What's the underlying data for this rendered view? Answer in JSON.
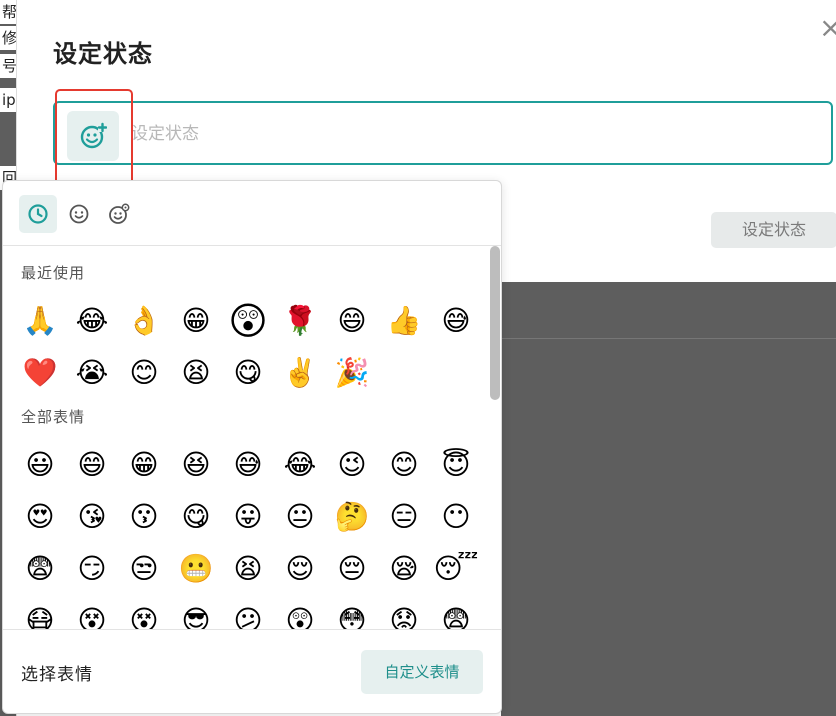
{
  "background": {
    "fragments": [
      "帮",
      "修",
      "号",
      "ip",
      "回"
    ]
  },
  "dialog": {
    "title": "设定状态",
    "close_glyph": "×",
    "input_placeholder": "设定状态",
    "confirm_label": "设定状态"
  },
  "picker": {
    "tabs": [
      {
        "icon": "clock-icon",
        "active": true
      },
      {
        "icon": "smiley-icon",
        "active": false
      },
      {
        "icon": "custom-emoji-icon",
        "active": false
      }
    ],
    "recent_title": "最近使用",
    "recent": [
      "🙏",
      "😂",
      "👌",
      "😁",
      "😲",
      "🌹",
      "😄",
      "👍",
      "😅",
      "❤️",
      "😭",
      "😊",
      "😫",
      "😋",
      "✌️",
      "🎉"
    ],
    "all_title": "全部表情",
    "all": [
      "😃",
      "😄",
      "😁",
      "😆",
      "😅",
      "😂",
      "😉",
      "😊",
      "😇",
      "😍",
      "😘",
      "😗",
      "😋",
      "😛",
      "😐",
      "🤔",
      "😑",
      "😶",
      "😨",
      "😏",
      "😒",
      "😬",
      "😫",
      "😌",
      "😔",
      "😪",
      "😴",
      "😷",
      "😵",
      "😵",
      "😎",
      "😕",
      "😲",
      "😳",
      "😟",
      "😨"
    ],
    "footer_label": "选择表情",
    "custom_label": "自定义表情"
  },
  "colors": {
    "accent": "#1f9e9a",
    "highlight": "#e53a2f",
    "overlay": "#5e5e5e"
  }
}
